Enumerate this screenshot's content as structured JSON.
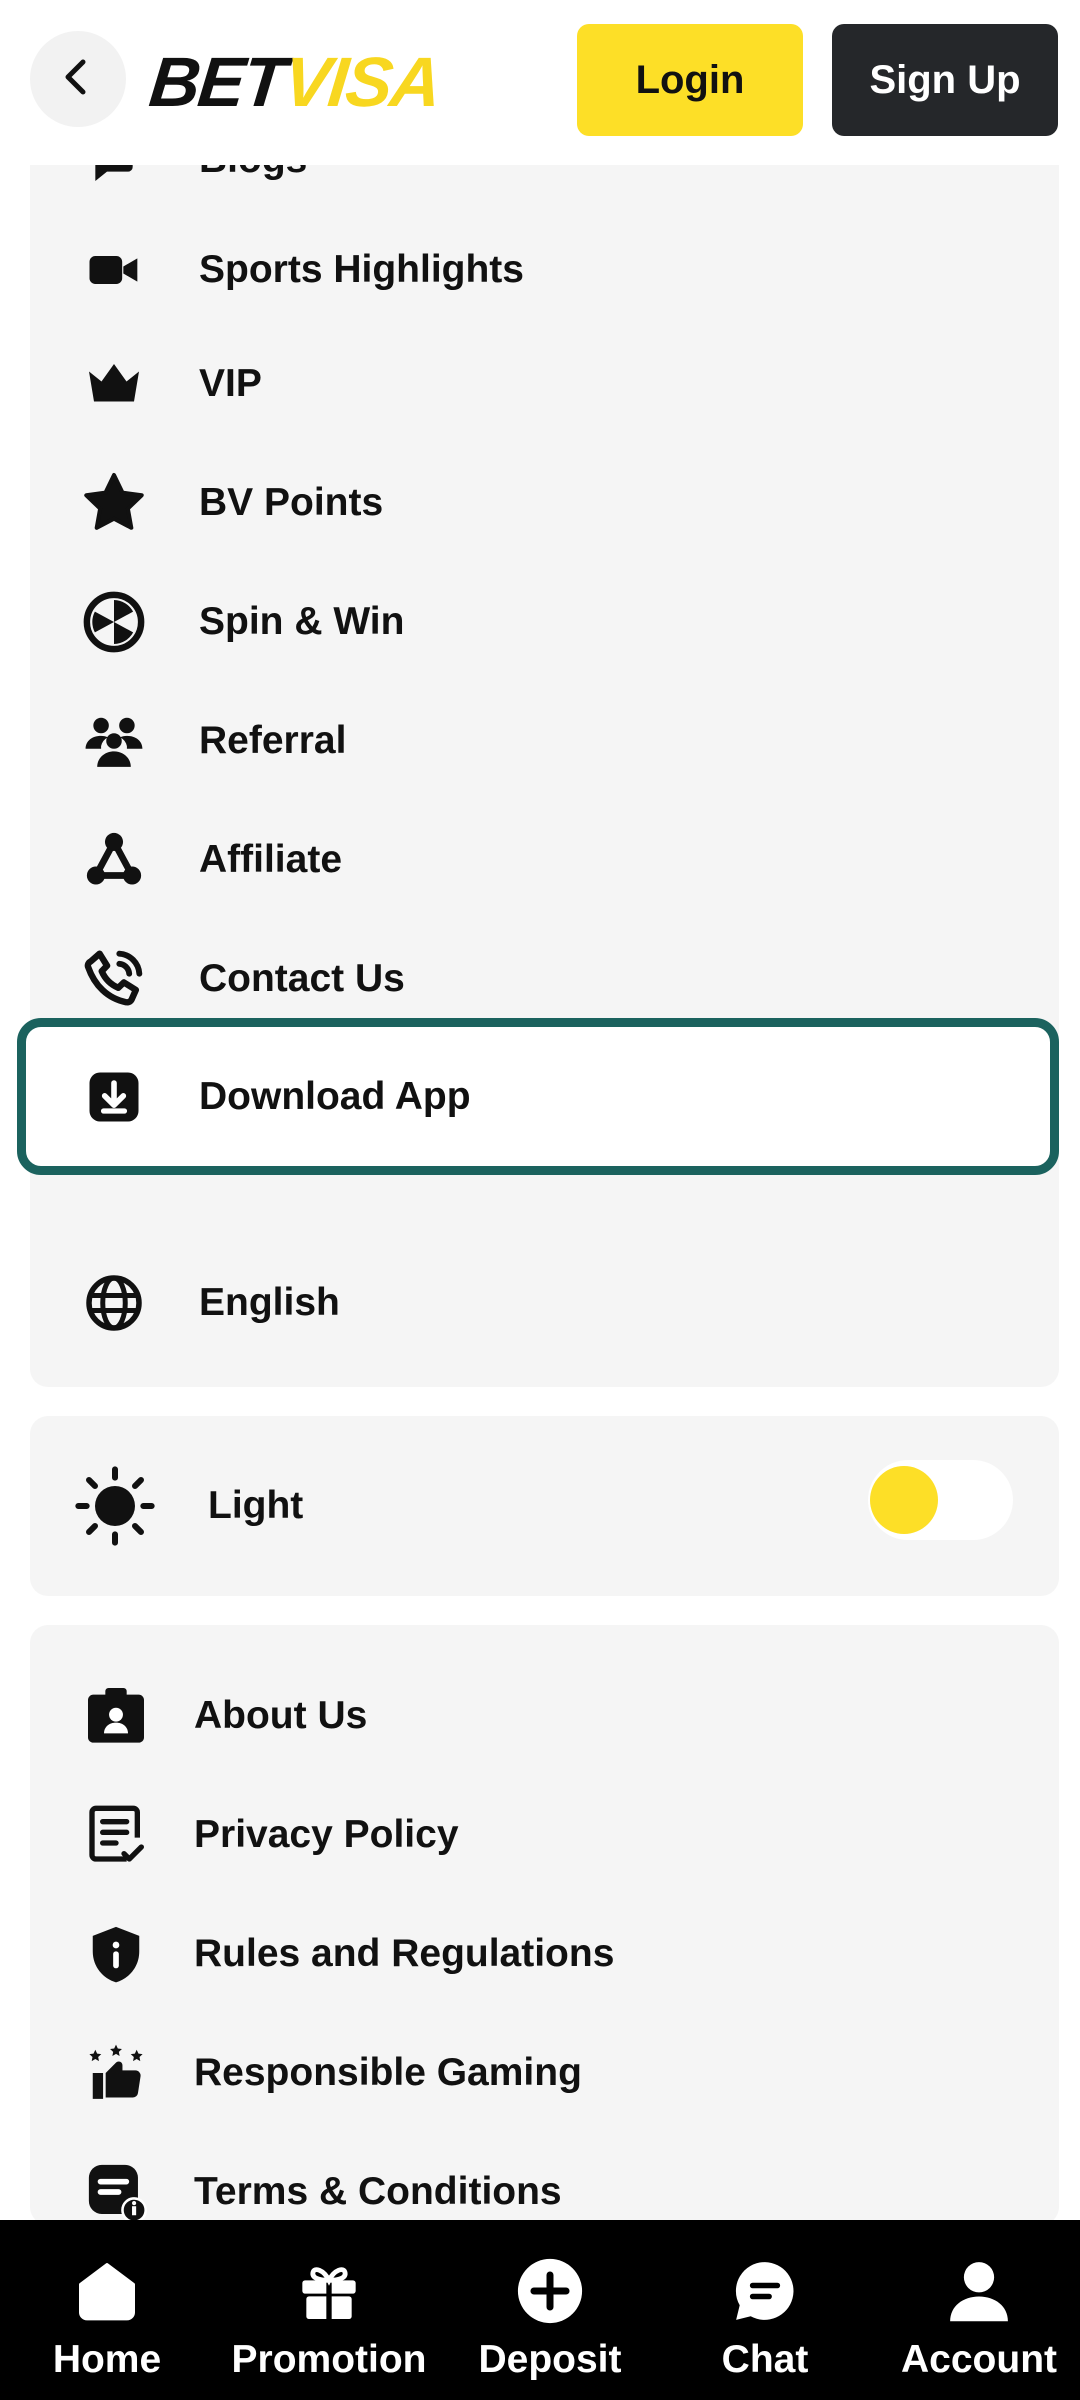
{
  "header": {
    "logo_part1": "BET",
    "logo_part2": "VISA",
    "login_label": "Login",
    "signup_label": "Sign Up"
  },
  "menu": {
    "items": [
      {
        "label": "Blogs",
        "icon": "blog-icon"
      },
      {
        "label": "Sports Highlights",
        "icon": "video-camera-icon"
      },
      {
        "label": "VIP",
        "icon": "crown-icon"
      },
      {
        "label": "BV Points",
        "icon": "star-icon"
      },
      {
        "label": "Spin & Win",
        "icon": "wheel-icon"
      },
      {
        "label": "Referral",
        "icon": "people-icon"
      },
      {
        "label": "Affiliate",
        "icon": "network-icon"
      },
      {
        "label": "Contact Us",
        "icon": "phone-icon"
      },
      {
        "label": "Download App",
        "icon": "download-icon"
      }
    ]
  },
  "language": {
    "label": "English",
    "icon": "globe-icon"
  },
  "theme": {
    "label": "Light",
    "icon": "sun-icon",
    "toggle_on": false
  },
  "info": {
    "items": [
      {
        "label": "About Us",
        "icon": "id-badge-icon"
      },
      {
        "label": "Privacy Policy",
        "icon": "document-check-icon"
      },
      {
        "label": "Rules and Regulations",
        "icon": "shield-info-icon"
      },
      {
        "label": "Responsible Gaming",
        "icon": "thumbs-up-stars-icon"
      },
      {
        "label": "Terms & Conditions",
        "icon": "terms-icon"
      }
    ]
  },
  "bottom_nav": {
    "items": [
      {
        "label": "Home",
        "icon": "home-icon"
      },
      {
        "label": "Promotion",
        "icon": "gift-icon"
      },
      {
        "label": "Deposit",
        "icon": "plus-circle-icon"
      },
      {
        "label": "Chat",
        "icon": "chat-icon"
      },
      {
        "label": "Account",
        "icon": "user-icon"
      }
    ]
  },
  "colors": {
    "accent_yellow": "#fddf27",
    "dark": "#25272a",
    "highlight_border": "#1b625e",
    "card_bg": "#f5f5f5"
  }
}
